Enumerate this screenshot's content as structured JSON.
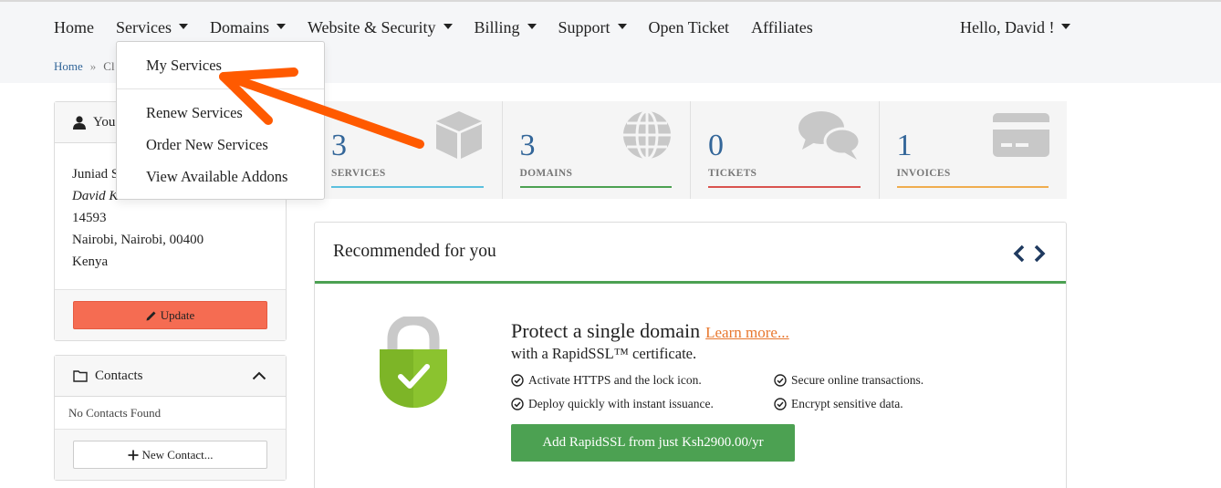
{
  "nav": {
    "items": [
      {
        "label": "Home",
        "caret": false
      },
      {
        "label": "Services",
        "caret": true
      },
      {
        "label": "Domains",
        "caret": true
      },
      {
        "label": "Website & Security",
        "caret": true
      },
      {
        "label": "Billing",
        "caret": true
      },
      {
        "label": "Support",
        "caret": true
      },
      {
        "label": "Open Ticket",
        "caret": false
      },
      {
        "label": "Affiliates",
        "caret": false
      }
    ],
    "user_greeting": "Hello, David !"
  },
  "breadcrumb": {
    "home": "Home",
    "separator": "»",
    "current": "Cl"
  },
  "services_dropdown": {
    "items": [
      "My Services",
      "Renew Services",
      "Order New Services",
      "View Available Addons"
    ]
  },
  "info_panel": {
    "title": "You",
    "lines": [
      "Juniad S",
      "David K",
      "14593",
      "Nairobi, Nairobi, 00400",
      "Kenya"
    ],
    "update_label": "Update"
  },
  "contacts_panel": {
    "title": "Contacts",
    "empty_text": "No Contacts Found",
    "new_label": "New Contact..."
  },
  "stats": [
    {
      "value": "3",
      "label": "SERVICES",
      "color": "#5bc0de",
      "icon": "box-icon"
    },
    {
      "value": "3",
      "label": "DOMAINS",
      "color": "#4ca152",
      "icon": "globe-icon"
    },
    {
      "value": "0",
      "label": "TICKETS",
      "color": "#d9534f",
      "icon": "chat-bubbles-icon"
    },
    {
      "value": "1",
      "label": "INVOICES",
      "color": "#f0ad4e",
      "icon": "credit-card-icon"
    }
  ],
  "recommended": {
    "title": "Recommended for you",
    "promo_title": "Protect a single domain",
    "learn_more": "Learn more...",
    "promo_sub": "with a RapidSSL™ certificate.",
    "features": [
      "Activate HTTPS and the lock icon.",
      "Secure online transactions.",
      "Deploy quickly with instant issuance.",
      "Encrypt sensitive data."
    ],
    "button_label": "Add RapidSSL from just Ksh2900.00/yr"
  },
  "colors": {
    "accent_blue": "#336699",
    "update_orange": "#f56c52",
    "green": "#4ca152",
    "arrow_orange": "#ff5a00",
    "learn_more": "#e8772e"
  }
}
